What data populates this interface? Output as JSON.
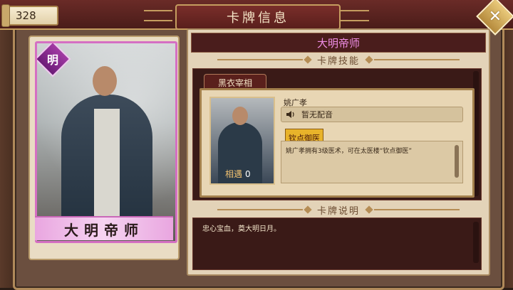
{
  "header": {
    "title": "卡牌信息",
    "counter": "328",
    "close_icon": "close-icon"
  },
  "card": {
    "badge": "明",
    "name": "大明帝师",
    "frame_color": "#d56fc3"
  },
  "detail": {
    "name": "大明帝师",
    "name_color": "#f08ee6",
    "skill_section_title": "卡牌技能",
    "skill_tab": "黑衣宰相",
    "skill_owner": "姚广孝",
    "voice_label": "暂无配音",
    "portrait_label": "相遇",
    "portrait_value": "0",
    "skill_name": "钦点御医",
    "skill_desc": "姚广孝拥有3级医术，可在太医楼“钦点御医”",
    "desc_section_title": "卡牌说明",
    "desc_text": "忠心宝血，奠大明日月。"
  }
}
